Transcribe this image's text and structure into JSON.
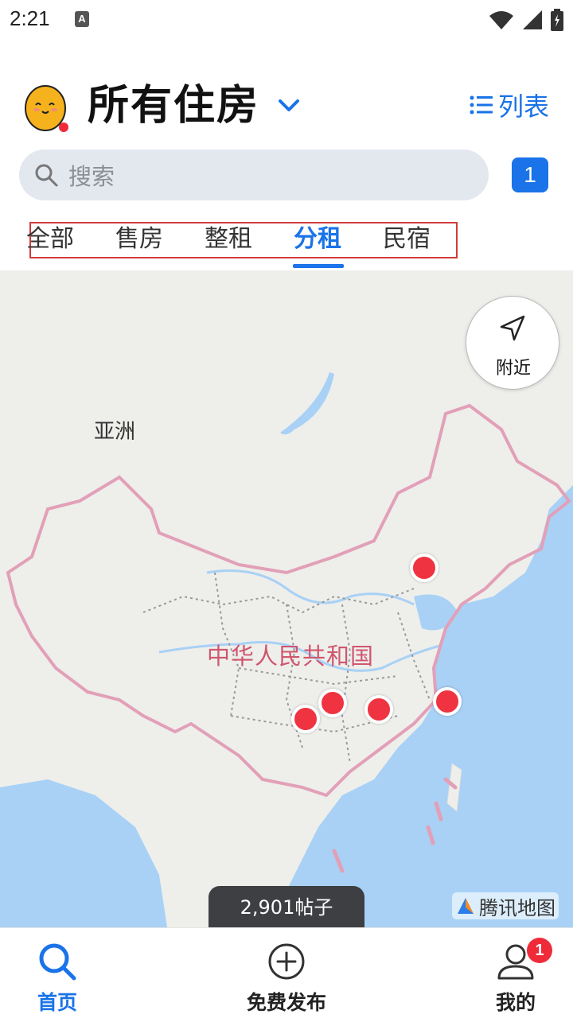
{
  "status_bar": {
    "time": "2:21",
    "notification_icon": "A",
    "icons": [
      "wifi-icon",
      "signal-icon",
      "battery-icon"
    ]
  },
  "header": {
    "title": "所有住房",
    "list_label": "列表",
    "avatar_icon": "egg-avatar-icon"
  },
  "search": {
    "placeholder": "搜索",
    "badge_count": "1"
  },
  "tabs": [
    {
      "label": "全部",
      "active": false
    },
    {
      "label": "售房",
      "active": false
    },
    {
      "label": "整租",
      "active": false
    },
    {
      "label": "分租",
      "active": true
    },
    {
      "label": "民宿",
      "active": false
    }
  ],
  "map": {
    "nearby_label": "附近",
    "continent_label": "亚洲",
    "country_label": "中华人民共和国",
    "provider_label": "腾讯地图",
    "post_count": "2,901帖子",
    "pin_count": 5
  },
  "bottom_nav": [
    {
      "label": "首页",
      "icon": "search-icon",
      "active": true
    },
    {
      "label": "免费发布",
      "icon": "plus-circle-icon",
      "active": false
    },
    {
      "label": "我的",
      "icon": "user-icon",
      "active": false,
      "badge": "1"
    }
  ],
  "colors": {
    "accent": "#1a73e8",
    "pin": "#ef3340",
    "border_highlight": "#d23b3b",
    "china_label": "#d0566e",
    "water": "#a8d1f5",
    "land": "#eeeeeb"
  }
}
